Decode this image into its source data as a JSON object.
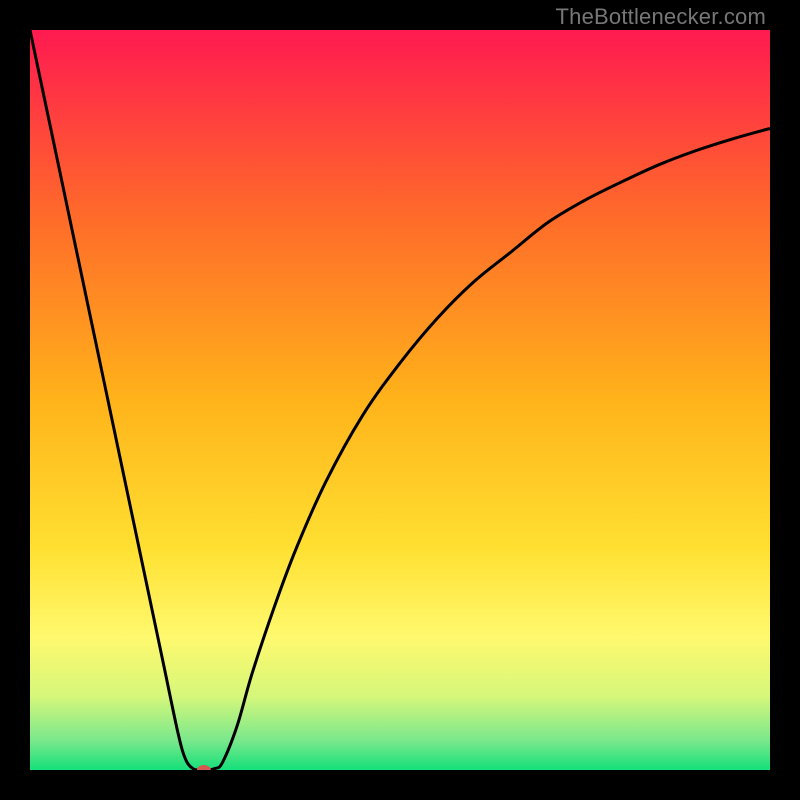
{
  "watermark": {
    "text": "TheBottlenecker.com"
  },
  "chart_data": {
    "type": "line",
    "title": "",
    "xlabel": "",
    "ylabel": "",
    "xlim": [
      0,
      100
    ],
    "ylim": [
      0,
      100
    ],
    "grid": false,
    "legend": false,
    "background_gradient": {
      "stops": [
        {
          "offset": 0.0,
          "color": "#ff1a50"
        },
        {
          "offset": 0.25,
          "color": "#ff6a2a"
        },
        {
          "offset": 0.5,
          "color": "#ffb31a"
        },
        {
          "offset": 0.7,
          "color": "#ffe031"
        },
        {
          "offset": 0.82,
          "color": "#fff96e"
        },
        {
          "offset": 0.9,
          "color": "#d6f77a"
        },
        {
          "offset": 0.96,
          "color": "#7ae88c"
        },
        {
          "offset": 1.0,
          "color": "#13e07a"
        }
      ]
    },
    "series": [
      {
        "name": "bottleneck-curve",
        "x": [
          0,
          2,
          4,
          6,
          8,
          10,
          12,
          14,
          16,
          18,
          20,
          21,
          22,
          23,
          24,
          25,
          26,
          28,
          30,
          33,
          36,
          40,
          45,
          50,
          55,
          60,
          65,
          70,
          75,
          80,
          85,
          90,
          95,
          100
        ],
        "y": [
          100,
          90.5,
          81,
          71.5,
          62,
          52.5,
          43,
          33.5,
          24,
          14.5,
          5,
          1.5,
          0.2,
          0.0,
          0.0,
          0.2,
          1.0,
          6,
          13,
          22,
          30,
          39,
          48,
          55,
          61,
          66,
          70,
          74,
          77,
          79.5,
          81.8,
          83.7,
          85.3,
          86.7
        ]
      }
    ],
    "marker": {
      "name": "optimum-point",
      "x": 23.5,
      "y": 0,
      "rx": 7,
      "ry": 5,
      "color": "#d65a4f"
    }
  }
}
